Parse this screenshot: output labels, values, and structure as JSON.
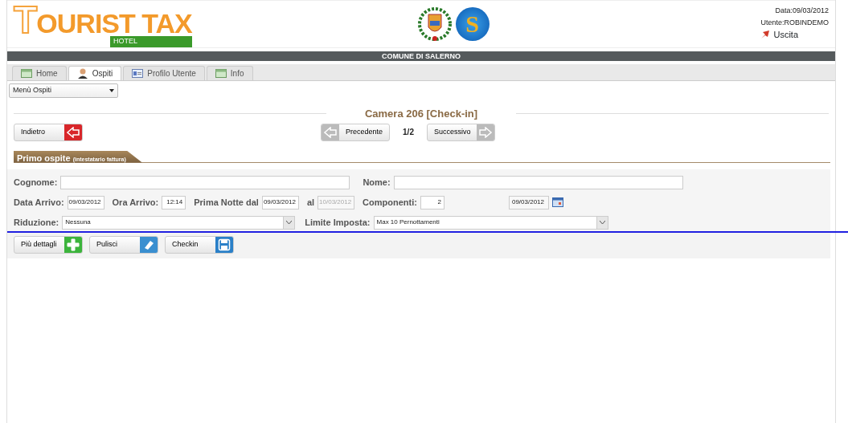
{
  "header": {
    "logo_text": "TOURIST TAX",
    "logo_subtitle": "HOTEL",
    "emblem_letter": "S",
    "date": "Data:09/03/2012",
    "user": "Utente:ROBINDEMO",
    "logout": "Uscita"
  },
  "banner": "COMUNE DI SALERNO",
  "tabs": [
    {
      "label": "Home",
      "selected": false
    },
    {
      "label": "Ospiti",
      "selected": true
    },
    {
      "label": "Profilo Utente",
      "selected": false
    },
    {
      "label": "Info",
      "selected": false
    }
  ],
  "menu_select": "Menù Ospiti",
  "page_title": "Camera 206 [Check-in]",
  "nav": {
    "back": "Indietro",
    "previous": "Precedente",
    "pager": "1/2",
    "next": "Successivo"
  },
  "section": {
    "title": "Primo ospite",
    "note": "(intestatario fattura)"
  },
  "form_rows": [
    [
      {
        "kind": "text",
        "label": "Cognome:"
      },
      {
        "kind": "text",
        "label": "Nome:"
      }
    ],
    [
      {
        "kind": "text",
        "label": "Data Arrivo:",
        "value": "09/03/2012"
      },
      {
        "kind": "text",
        "label": "Ora Arrivo:",
        "value": "12:14"
      },
      {
        "kind": "text",
        "label": "Prima Notte dal",
        "value": "09/03/2012",
        "disabled": false
      },
      {
        "kind": "text",
        "label": "al",
        "value": "10/03/2012",
        "disabled": true
      },
      {
        "kind": "text",
        "label": "Componenti:",
        "value": "2"
      },
      {
        "kind": "date",
        "value": "09/03/2012"
      }
    ],
    [
      {
        "kind": "select",
        "label": "Riduzione:",
        "value": "Nessuna"
      },
      {
        "kind": "select",
        "label": "Limite Imposta:",
        "value": "Max 10 Pernottamenti"
      }
    ]
  ],
  "actions": [
    {
      "label": "Più dettagli"
    },
    {
      "label": "Pulisci"
    },
    {
      "label": "Checkin"
    }
  ]
}
